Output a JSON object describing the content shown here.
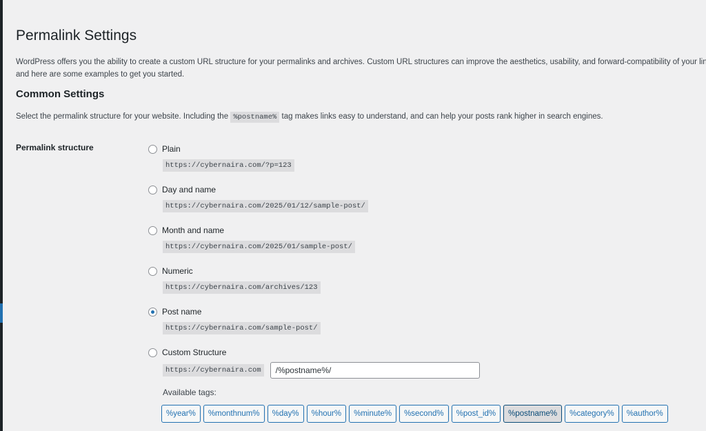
{
  "page": {
    "title": "Permalink Settings",
    "intro_line1": "WordPress offers you the ability to create a custom URL structure for your permalinks and archives. Custom URL structures can improve the aesthetics, usability, and forward-compatibility of your links. A",
    "intro_line2": "and here are some examples to get you started."
  },
  "common": {
    "heading": "Common Settings",
    "desc_before": "Select the permalink structure for your website. Including the",
    "desc_code": "%postname%",
    "desc_after": "tag makes links easy to understand, and can help your posts rank higher in search engines."
  },
  "permalink": {
    "label": "Permalink structure",
    "options": [
      {
        "label": "Plain",
        "sample": "https://cybernaira.com/?p=123",
        "checked": false
      },
      {
        "label": "Day and name",
        "sample": "https://cybernaira.com/2025/01/12/sample-post/",
        "checked": false
      },
      {
        "label": "Month and name",
        "sample": "https://cybernaira.com/2025/01/sample-post/",
        "checked": false
      },
      {
        "label": "Numeric",
        "sample": "https://cybernaira.com/archives/123",
        "checked": false
      },
      {
        "label": "Post name",
        "sample": "https://cybernaira.com/sample-post/",
        "checked": true
      }
    ],
    "custom": {
      "label": "Custom Structure",
      "base": "https://cybernaira.com",
      "value": "/%postname%/",
      "available_tags_label": "Available tags:",
      "tags": [
        "%year%",
        "%monthnum%",
        "%day%",
        "%hour%",
        "%minute%",
        "%second%",
        "%post_id%",
        "%postname%",
        "%category%",
        "%author%"
      ],
      "active_tag": "%postname%"
    }
  },
  "colors": {
    "accent": "#2271b1",
    "background": "#f0f0f1",
    "code_bg": "#dcdcde"
  }
}
